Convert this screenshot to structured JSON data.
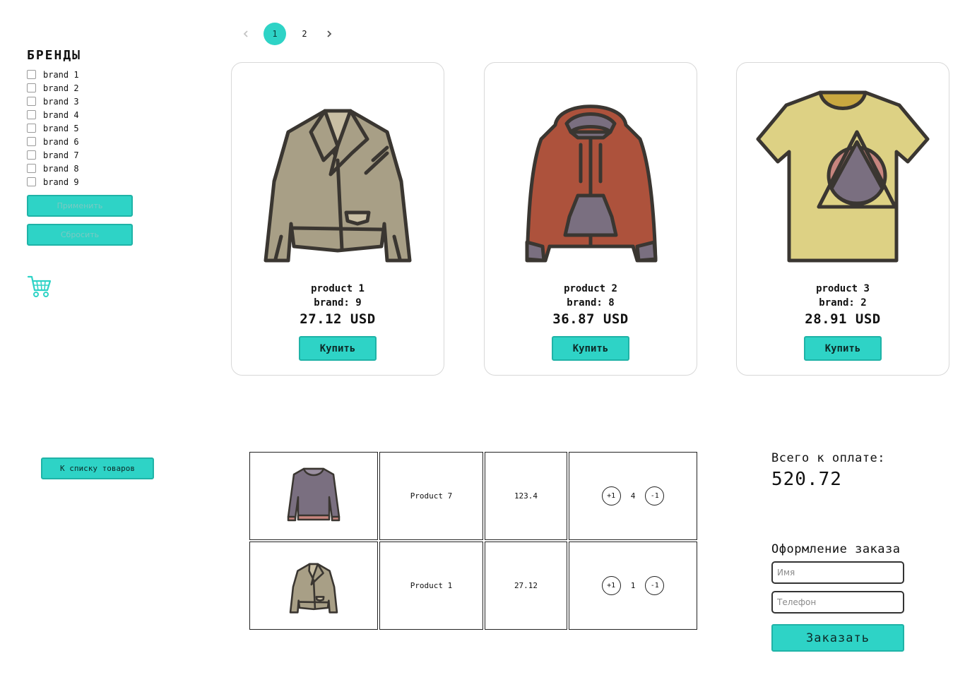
{
  "colors": {
    "accent": "#2ed3c6",
    "accent_border": "#1fb3a7"
  },
  "pagination": {
    "prev_icon": "chevron-left-icon",
    "next_icon": "chevron-right-icon",
    "pages": [
      "1",
      "2"
    ],
    "active": "1"
  },
  "sidebar": {
    "title": "БРЕНДЫ",
    "brands": [
      "brand 1",
      "brand 2",
      "brand 3",
      "brand 4",
      "brand 5",
      "brand 6",
      "brand 7",
      "brand 8",
      "brand 9"
    ],
    "apply_label": "Применить",
    "reset_label": "Сбросить",
    "cart_icon": "cart-icon"
  },
  "products": [
    {
      "name": "product 1",
      "brand": "brand: 9",
      "price": "27.12 USD",
      "buy_label": "Купить",
      "image": "leather-jacket"
    },
    {
      "name": "product 2",
      "brand": "brand: 8",
      "price": "36.87 USD",
      "buy_label": "Купить",
      "image": "hoodie"
    },
    {
      "name": "product 3",
      "brand": "brand: 2",
      "price": "28.91 USD",
      "buy_label": "Купить",
      "image": "t-shirt"
    }
  ],
  "cart": {
    "back_label": "К списку товаров",
    "rows": [
      {
        "image": "sweater",
        "name": "Product 7",
        "price": "123.4",
        "qty": "4",
        "plus": "+1",
        "minus": "-1"
      },
      {
        "image": "leather-jacket",
        "name": "Product 1",
        "price": "27.12",
        "qty": "1",
        "plus": "+1",
        "minus": "-1"
      }
    ],
    "total_label": "Всего к оплате:",
    "total_value": "520.72"
  },
  "order": {
    "title": "Оформление заказа",
    "name_placeholder": "Имя",
    "phone_placeholder": "Телефон",
    "submit_label": "Заказать"
  }
}
